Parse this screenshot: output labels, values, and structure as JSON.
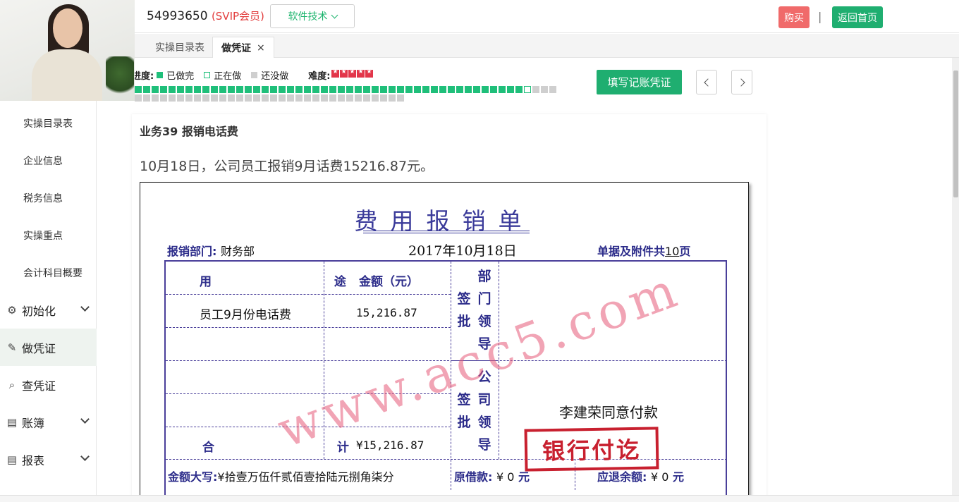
{
  "account": {
    "id": "54993650",
    "vip": "(SVIP会员)"
  },
  "header": {
    "software_label": "软件技术",
    "buy_label": "购买",
    "separator": "|",
    "home_label": "返回首页"
  },
  "tabs": [
    {
      "label": "实操目录表"
    },
    {
      "label": "做凭证",
      "close": "×"
    }
  ],
  "sidebar": {
    "items": [
      {
        "label": "实操目录表"
      },
      {
        "label": "企业信息"
      },
      {
        "label": "税务信息"
      },
      {
        "label": "实操重点"
      },
      {
        "label": "会计科目概要"
      }
    ],
    "groups": [
      {
        "label": "初始化",
        "icon": "gear-icon",
        "glyph": "⚙"
      },
      {
        "label": "做凭证",
        "icon": "pen-icon",
        "glyph": "✎"
      },
      {
        "label": "查凭证",
        "icon": "search-icon",
        "glyph": "🔍"
      },
      {
        "label": "账簿",
        "icon": "book-icon",
        "glyph": "▤"
      },
      {
        "label": "报表",
        "icon": "report-icon",
        "glyph": "▤"
      }
    ]
  },
  "progress": {
    "label": "进度:",
    "done_label": "已做完",
    "doing_label": "正在做",
    "todo_label": "还没做",
    "difficulty_label": "难度:",
    "difficulty_stars": 5,
    "done_count": 46,
    "doing_index": 47,
    "total": 82
  },
  "actions": {
    "fill_label": "填写记账凭证"
  },
  "task": {
    "title": "业务39 报销电话费",
    "desc": "10月18日，公司员工报销9月话费15216.87元。"
  },
  "voucher": {
    "title": "费用报销单",
    "dept_label": "报销部门:",
    "dept_value": "财务部",
    "date": "2017年10月18日",
    "attach_label": "单据及附件共",
    "attach_value": "10",
    "attach_unit": "页",
    "col_use": "用 途",
    "col_amount": "金额（元）",
    "item_use": "员工9月份电话费",
    "item_amount": "15,216.87",
    "dept_sign": [
      "部",
      "门",
      "领",
      "导"
    ],
    "sign_label": [
      "签",
      "批"
    ],
    "company_sign": [
      "公",
      "司",
      "领",
      "导"
    ],
    "total_label": "合 计",
    "total_amount": "¥15,216.87",
    "capital_label": "金额大写:",
    "capital_value": "¥拾壹万伍仟贰佰壹拾陆元捌角柒分",
    "borrow_label": "原借款:",
    "borrow_value": "¥ 0",
    "borrow_unit": "元",
    "refund_label": "应退余额:",
    "refund_value": "¥ 0",
    "refund_unit": "元",
    "approval": "李建荣同意付款",
    "stamp": "银行付讫",
    "watermark": "www.acc5.com"
  }
}
